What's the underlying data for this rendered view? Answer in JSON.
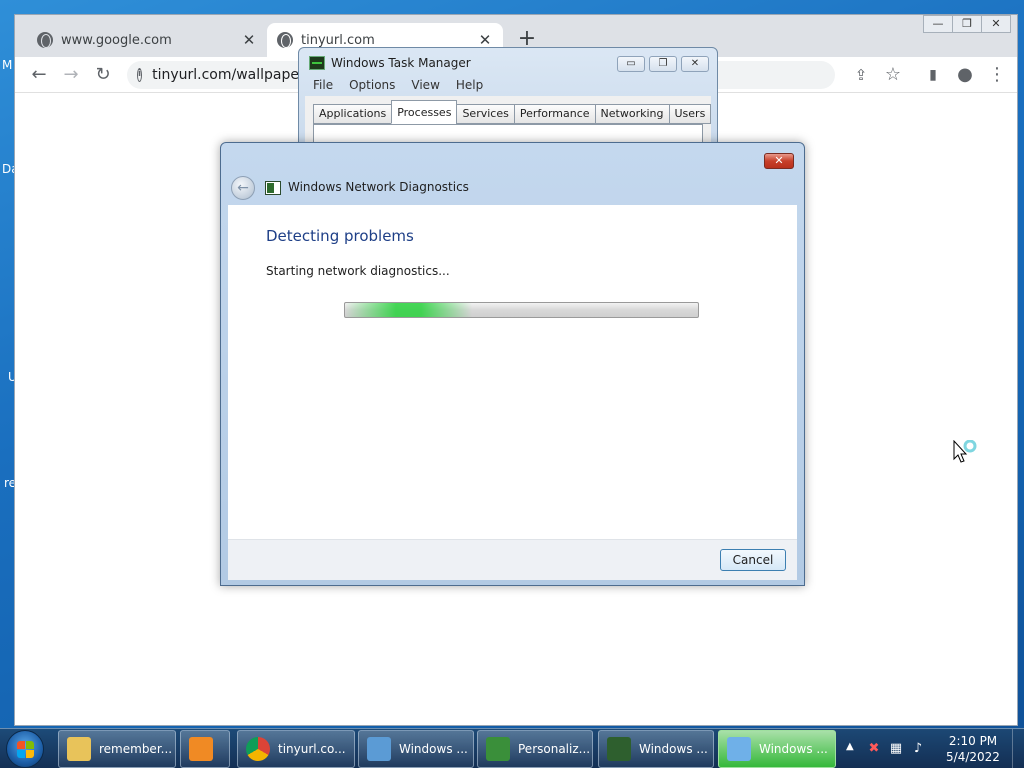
{
  "desktop": {
    "fragments": [
      "M",
      "Da",
      "U",
      "re"
    ]
  },
  "chrome": {
    "tabs": [
      {
        "title": "www.google.com",
        "close": "✕"
      },
      {
        "title": "tinyurl.com",
        "close": "✕"
      }
    ],
    "new_tab": "+",
    "window_controls": {
      "minimize": "—",
      "restore": "❐",
      "close": "✕"
    },
    "nav": {
      "back": "←",
      "forward": "→",
      "reload": "↻"
    },
    "address": "tinyurl.com/wallpaperl",
    "toolbar_icons": {
      "share": "⇪",
      "star": "☆",
      "sidepanel": "▮",
      "profile": "●",
      "menu": "⋮"
    }
  },
  "taskmgr": {
    "title": "Windows Task Manager",
    "controls": {
      "minimize": "▭",
      "restore": "❐",
      "close": "✕"
    },
    "menu": [
      "File",
      "Options",
      "View",
      "Help"
    ],
    "tabs": [
      "Applications",
      "Processes",
      "Services",
      "Performance",
      "Networking",
      "Users"
    ],
    "active_tab": "Processes"
  },
  "diagnostics": {
    "title": "Windows Network Diagnostics",
    "close": "✕",
    "back": "←",
    "heading": "Detecting problems",
    "status": "Starting network diagnostics...",
    "progress": {
      "indeterminate": true,
      "highlight_start": 0.0,
      "highlight_end": 0.36
    },
    "cancel": "Cancel"
  },
  "taskbar": {
    "buttons": [
      {
        "label": "remember...",
        "icon": "folder-icon",
        "color": "#e8c35a"
      },
      {
        "label": "",
        "icon": "media-player-icon",
        "color": "#f08a24"
      },
      {
        "label": "tinyurl.co...",
        "icon": "chrome-icon",
        "color": "#db4437"
      },
      {
        "label": "Windows ...",
        "icon": "windows-update-icon",
        "color": "#5b9bd5"
      },
      {
        "label": "Personaliz...",
        "icon": "personalize-icon",
        "color": "#3a8f3a"
      },
      {
        "label": "Windows ...",
        "icon": "task-manager-icon",
        "color": "#2e5f2e"
      },
      {
        "label": "Windows ...",
        "icon": "network-diagnostics-icon",
        "color": "#6fb0e8",
        "active": true
      }
    ],
    "tray_arrow": "▲",
    "tray_icons": [
      "network-error-icon",
      "network-icon",
      "volume-icon"
    ],
    "clock_time": "2:10 PM",
    "clock_date": "5/4/2022"
  }
}
